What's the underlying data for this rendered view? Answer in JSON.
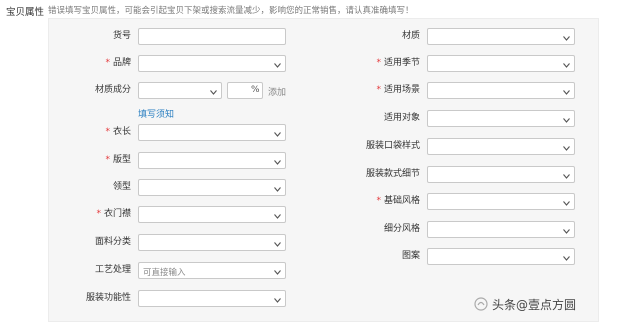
{
  "section_title": "宝贝属性",
  "hint": "错误填写宝贝属性，可能会引起宝贝下架或搜索流量减少，影响您的正常销售，请认真准确填写！",
  "left_fields": [
    {
      "label": "货号",
      "required": false,
      "type": "text"
    },
    {
      "label": "品牌",
      "required": true,
      "type": "select"
    },
    {
      "label": "材质成分",
      "required": false,
      "type": "composition"
    },
    {
      "label": "衣长",
      "required": true,
      "type": "select"
    },
    {
      "label": "版型",
      "required": true,
      "type": "select"
    },
    {
      "label": "领型",
      "required": false,
      "type": "select"
    },
    {
      "label": "衣门襟",
      "required": true,
      "type": "select"
    },
    {
      "label": "面料分类",
      "required": false,
      "type": "select"
    },
    {
      "label": "工艺处理",
      "required": false,
      "type": "select",
      "placeholder": "可直接输入"
    },
    {
      "label": "服装功能性",
      "required": false,
      "type": "select"
    }
  ],
  "right_fields": [
    {
      "label": "材质",
      "required": false,
      "type": "select"
    },
    {
      "label": "适用季节",
      "required": true,
      "type": "select"
    },
    {
      "label": "适用场景",
      "required": true,
      "type": "select"
    },
    {
      "label": "适用对象",
      "required": false,
      "type": "select"
    },
    {
      "label": "服装口袋样式",
      "required": false,
      "type": "select"
    },
    {
      "label": "服装款式细节",
      "required": false,
      "type": "select"
    },
    {
      "label": "基础风格",
      "required": true,
      "type": "select"
    },
    {
      "label": "细分风格",
      "required": false,
      "type": "select"
    },
    {
      "label": "图案",
      "required": false,
      "type": "select"
    }
  ],
  "composition": {
    "percent_unit": "%",
    "add_label": "添加",
    "help_link": "填写须知"
  },
  "watermark": "头条@壹点方圆",
  "colors": {
    "required": "#e4393c",
    "link": "#2a7fc1",
    "panel": "#f6f6f6",
    "border": "#c9c9c9"
  }
}
